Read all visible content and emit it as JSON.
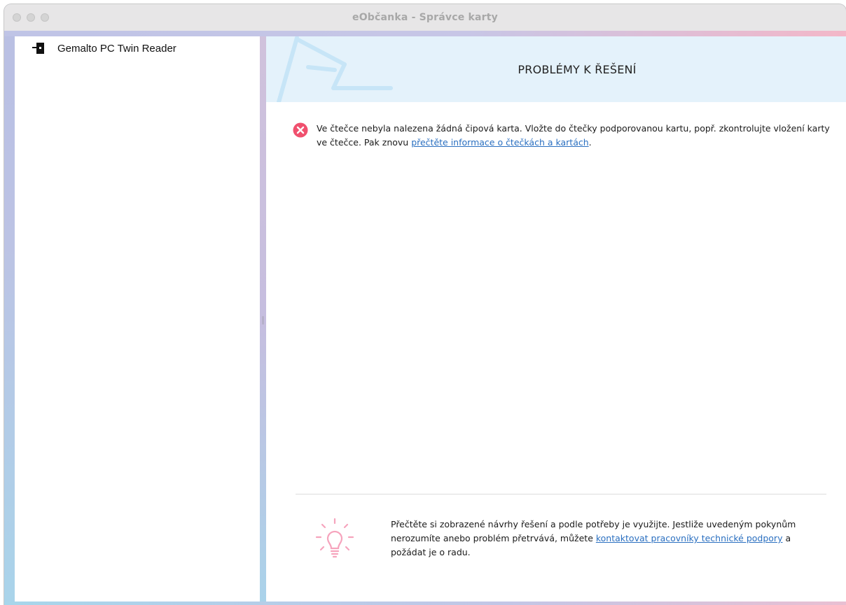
{
  "window": {
    "title": "eObčanka - Správce karty"
  },
  "sidebar": {
    "items": [
      {
        "label": "Gemalto PC Twin Reader",
        "icon": "card-reader-icon"
      }
    ]
  },
  "main": {
    "header_title": "PROBLÉMY K ŘEŠENÍ",
    "error": {
      "icon": "error-icon",
      "text_part1": "Ve čtečce nebyla nalezena žádná čipová karta. Vložte do čtečky podporovanou kartu, popř. zkontrolujte vložení karty ve čtečce. Pak znovu ",
      "link": "přečtěte informace o čtečkách a kartách",
      "text_part2": "."
    },
    "tip": {
      "icon": "lightbulb-icon",
      "text_part1": "Přečtěte si zobrazené návrhy řešení a podle potřeby je využijte. Jestliže uvedeným pokynům nerozumíte anebo problém přetrvává, můžete ",
      "link": "kontaktovat pracovníky technické podpory",
      "text_part2": " a požádat je o radu."
    }
  },
  "colors": {
    "link": "#2a6fc0",
    "error": "#f0506e",
    "tip_icon": "#f6a4bd",
    "header_bg": "#e4f2fb",
    "accent_pink": "#f3b7c8"
  }
}
